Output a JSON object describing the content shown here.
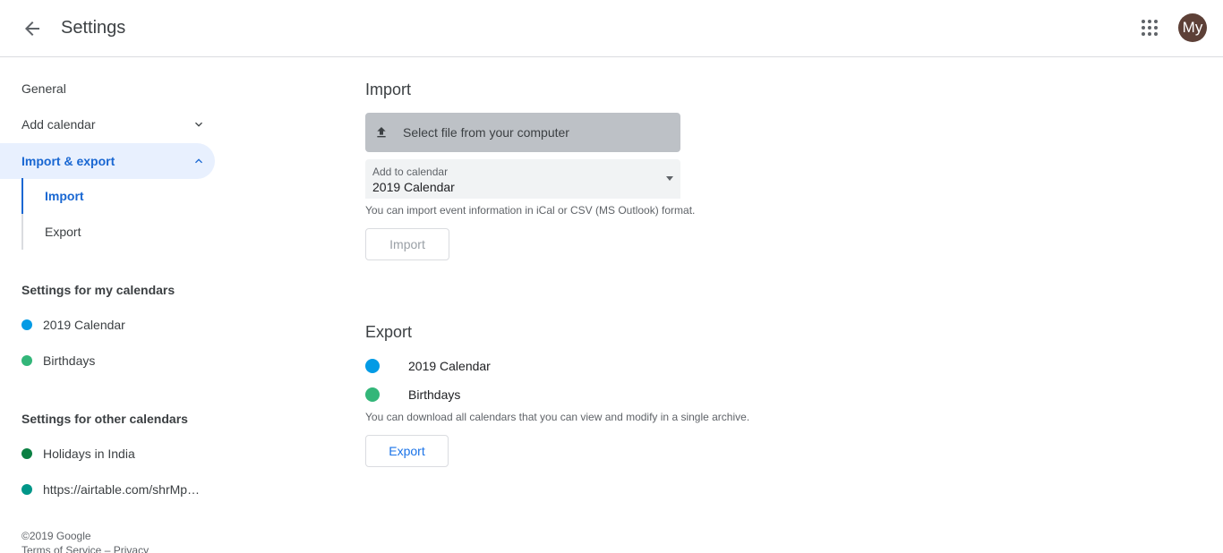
{
  "header": {
    "title": "Settings",
    "avatar_text": "My"
  },
  "sidebar": {
    "general": "General",
    "add_calendar": "Add calendar",
    "import_export": "Import & export",
    "import": "Import",
    "export": "Export",
    "my_calendars_label": "Settings for my calendars",
    "my_calendars": [
      {
        "name": "2019 Calendar",
        "color": "#039be5"
      },
      {
        "name": "Birthdays",
        "color": "#33b679"
      }
    ],
    "other_calendars_label": "Settings for other calendars",
    "other_calendars": [
      {
        "name": "Holidays in India",
        "color": "#0b8043"
      },
      {
        "name": "https://airtable.com/shrMp…",
        "color": "#009688"
      }
    ],
    "footer": {
      "copyright": "©2019 Google",
      "terms": "Terms of Service",
      "separator": "–",
      "privacy": "Privacy"
    }
  },
  "import_section": {
    "title": "Import",
    "select_file": "Select file from your computer",
    "add_to_calendar_label": "Add to calendar",
    "add_to_calendar_value": "2019 Calendar",
    "hint": "You can import event information in iCal or CSV (MS Outlook) format.",
    "button": "Import"
  },
  "export_section": {
    "title": "Export",
    "calendars": [
      {
        "name": "2019 Calendar",
        "color": "#039be5"
      },
      {
        "name": "Birthdays",
        "color": "#33b679"
      }
    ],
    "hint": "You can download all calendars that you can view and modify in a single archive.",
    "button": "Export"
  }
}
